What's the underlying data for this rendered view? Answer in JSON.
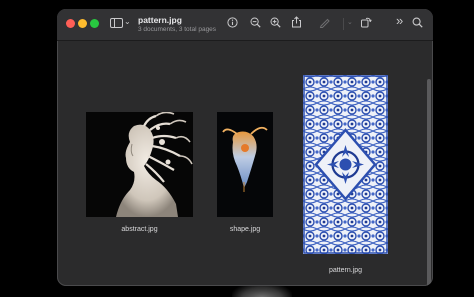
{
  "window": {
    "title": "pattern.jpg",
    "subtitle": "3 documents, 3 total pages"
  },
  "toolbar": {
    "icons": [
      "sidebar-toggle-icon",
      "chevron-down-icon",
      "info-icon",
      "zoom-out-icon",
      "zoom-in-icon",
      "share-icon",
      "markup-icon",
      "rotate-icon",
      "more-icon",
      "search-icon"
    ]
  },
  "documents": [
    {
      "caption": "abstract.jpg"
    },
    {
      "caption": "shape.jpg"
    },
    {
      "caption": "pattern.jpg"
    }
  ],
  "colors": {
    "window_bg": "#2b2b2c",
    "toolbar_bg": "#323234",
    "close": "#ff5f57",
    "minimize": "#febc2e",
    "maximize": "#28c840",
    "pattern_blue": "#2c4fb0"
  }
}
